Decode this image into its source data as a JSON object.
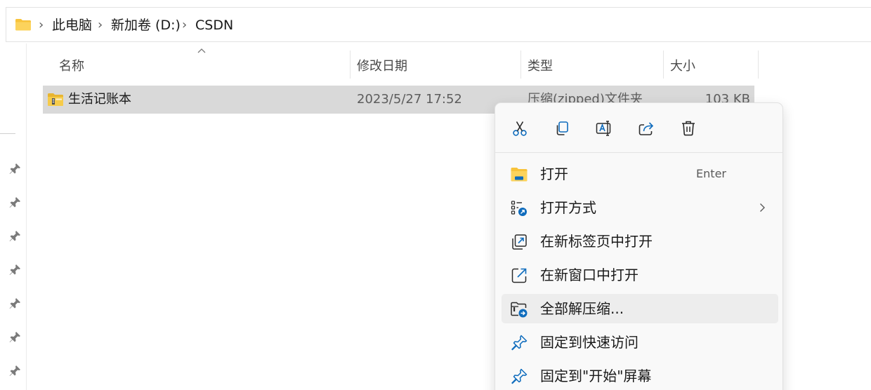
{
  "address_bar": {
    "breadcrumbs": [
      "此电脑",
      "新加卷 (D:)",
      "CSDN"
    ],
    "separator": "›",
    "folder_icon": "folder-icon"
  },
  "columns": {
    "name": "名称",
    "date_modified": "修改日期",
    "type": "类型",
    "size": "大小"
  },
  "files": [
    {
      "name": "生活记账本",
      "date_modified": "2023/5/27 17:52",
      "type": "压缩(zipped)文件夹",
      "size": "103 KB",
      "icon": "zip-folder-icon",
      "selected": true
    }
  ],
  "context_menu": {
    "quick_actions": [
      {
        "name": "cut",
        "icon": "scissors-icon"
      },
      {
        "name": "copy",
        "icon": "copy-icon"
      },
      {
        "name": "rename",
        "icon": "rename-icon"
      },
      {
        "name": "share",
        "icon": "share-icon"
      },
      {
        "name": "delete",
        "icon": "trash-icon"
      }
    ],
    "items": [
      {
        "label": "打开",
        "accelerator": "Enter",
        "icon": "folder-open-icon"
      },
      {
        "label": "打开方式",
        "has_submenu": true,
        "icon": "open-with-icon"
      },
      {
        "label": "在新标签页中打开",
        "icon": "new-tab-icon"
      },
      {
        "label": "在新窗口中打开",
        "icon": "new-window-icon"
      },
      {
        "label": "全部解压缩...",
        "icon": "extract-all-icon",
        "highlighted": true
      },
      {
        "label": "固定到快速访问",
        "icon": "pin-icon"
      },
      {
        "label": "固定到\"开始\"屏幕",
        "icon": "pin-icon"
      }
    ]
  },
  "colors": {
    "accent": "#0f6cbd",
    "folder_yellow": "#f8c33b",
    "selection": "#d9d9d9",
    "menu_bg": "#f9f9f9",
    "menu_hover": "#ededed"
  }
}
